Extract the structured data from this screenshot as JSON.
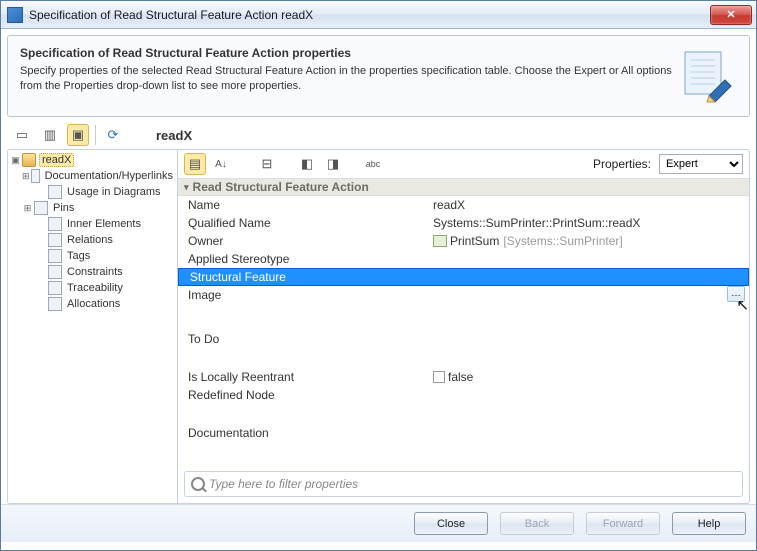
{
  "window": {
    "title": "Specification of Read Structural Feature Action readX"
  },
  "header": {
    "title": "Specification of Read Structural Feature Action properties",
    "description": "Specify properties of the selected Read Structural Feature Action in the properties specification table. Choose the Expert or All options from the Properties drop-down list to see more properties."
  },
  "heading": "readX",
  "tree": {
    "root": "readX",
    "items": [
      "Documentation/Hyperlinks",
      "Usage in Diagrams",
      "Pins",
      "Inner Elements",
      "Relations",
      "Tags",
      "Constraints",
      "Traceability",
      "Allocations"
    ]
  },
  "propertiesLabel": "Properties:",
  "propertiesValue": "Expert",
  "group": "Read Structural Feature Action",
  "rows": {
    "name_label": "Name",
    "name_value": "readX",
    "qname_label": "Qualified Name",
    "qname_value": "Systems::SumPrinter::PrintSum::readX",
    "owner_label": "Owner",
    "owner_value": "PrintSum",
    "owner_suffix": "[Systems::SumPrinter]",
    "stereo_label": "Applied Stereotype",
    "sf_label": "Structural Feature",
    "image_label": "Image",
    "todo_label": "To Do",
    "local_label": "Is Locally Reentrant",
    "local_value": "false",
    "redef_label": "Redefined Node",
    "doc_label": "Documentation"
  },
  "filter": {
    "placeholder": "Type here to filter properties"
  },
  "footer": {
    "close": "Close",
    "back": "Back",
    "forward": "Forward",
    "help": "Help"
  }
}
